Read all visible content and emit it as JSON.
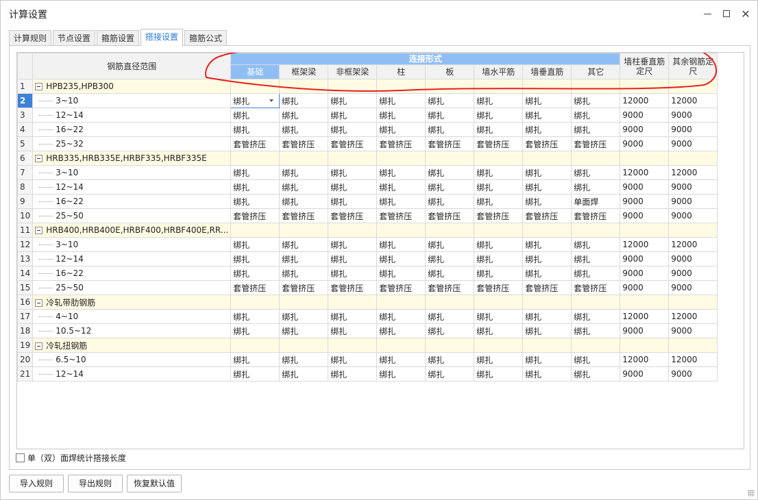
{
  "window": {
    "title": "计算设置"
  },
  "tabs": [
    {
      "label": "计算规则",
      "active": false
    },
    {
      "label": "节点设置",
      "active": false
    },
    {
      "label": "箍筋设置",
      "active": false
    },
    {
      "label": "搭接设置",
      "active": true
    },
    {
      "label": "箍筋公式",
      "active": false
    }
  ],
  "table": {
    "header": {
      "range": "钢筋直径范围",
      "group": "连接形式",
      "columns": [
        "基础",
        "框架梁",
        "非框架梁",
        "柱",
        "板",
        "墙水平筋",
        "墙垂直筋",
        "其它"
      ],
      "col_length1": "墙柱垂直筋定尺",
      "col_length2": "其余钢筋定尺"
    },
    "rows": [
      {
        "num": "1",
        "group": true,
        "name": "HPB235,HPB300"
      },
      {
        "num": "2",
        "group": false,
        "name": "3~10",
        "values": [
          "绑扎",
          "绑扎",
          "绑扎",
          "绑扎",
          "绑扎",
          "绑扎",
          "绑扎",
          "绑扎"
        ],
        "len1": "12000",
        "len2": "12000"
      },
      {
        "num": "3",
        "group": false,
        "name": "12~14",
        "values": [
          "绑扎",
          "绑扎",
          "绑扎",
          "绑扎",
          "绑扎",
          "绑扎",
          "绑扎",
          "绑扎"
        ],
        "len1": "9000",
        "len2": "9000"
      },
      {
        "num": "4",
        "group": false,
        "name": "16~22",
        "values": [
          "绑扎",
          "绑扎",
          "绑扎",
          "绑扎",
          "绑扎",
          "绑扎",
          "绑扎",
          "绑扎"
        ],
        "len1": "9000",
        "len2": "9000"
      },
      {
        "num": "5",
        "group": false,
        "name": "25~32",
        "values": [
          "套管挤压",
          "套管挤压",
          "套管挤压",
          "套管挤压",
          "套管挤压",
          "套管挤压",
          "套管挤压",
          "套管挤压"
        ],
        "len1": "9000",
        "len2": "9000"
      },
      {
        "num": "6",
        "group": true,
        "name": "HRB335,HRB335E,HRBF335,HRBF335E"
      },
      {
        "num": "7",
        "group": false,
        "name": "3~10",
        "values": [
          "绑扎",
          "绑扎",
          "绑扎",
          "绑扎",
          "绑扎",
          "绑扎",
          "绑扎",
          "绑扎"
        ],
        "len1": "12000",
        "len2": "12000"
      },
      {
        "num": "8",
        "group": false,
        "name": "12~14",
        "values": [
          "绑扎",
          "绑扎",
          "绑扎",
          "绑扎",
          "绑扎",
          "绑扎",
          "绑扎",
          "绑扎"
        ],
        "len1": "9000",
        "len2": "9000"
      },
      {
        "num": "9",
        "group": false,
        "name": "16~22",
        "values": [
          "绑扎",
          "绑扎",
          "绑扎",
          "绑扎",
          "绑扎",
          "绑扎",
          "绑扎",
          "单面焊"
        ],
        "len1": "9000",
        "len2": "9000"
      },
      {
        "num": "10",
        "group": false,
        "name": "25~50",
        "values": [
          "套管挤压",
          "套管挤压",
          "套管挤压",
          "套管挤压",
          "套管挤压",
          "套管挤压",
          "套管挤压",
          "套管挤压"
        ],
        "len1": "9000",
        "len2": "9000"
      },
      {
        "num": "11",
        "group": true,
        "name": "HRB400,HRB400E,HRBF400,HRBF400E,RR..."
      },
      {
        "num": "12",
        "group": false,
        "name": "3~10",
        "values": [
          "绑扎",
          "绑扎",
          "绑扎",
          "绑扎",
          "绑扎",
          "绑扎",
          "绑扎",
          "绑扎"
        ],
        "len1": "12000",
        "len2": "12000"
      },
      {
        "num": "13",
        "group": false,
        "name": "12~14",
        "values": [
          "绑扎",
          "绑扎",
          "绑扎",
          "绑扎",
          "绑扎",
          "绑扎",
          "绑扎",
          "绑扎"
        ],
        "len1": "9000",
        "len2": "9000"
      },
      {
        "num": "14",
        "group": false,
        "name": "16~22",
        "values": [
          "绑扎",
          "绑扎",
          "绑扎",
          "绑扎",
          "绑扎",
          "绑扎",
          "绑扎",
          "绑扎"
        ],
        "len1": "9000",
        "len2": "9000"
      },
      {
        "num": "15",
        "group": false,
        "name": "25~50",
        "values": [
          "套管挤压",
          "套管挤压",
          "套管挤压",
          "套管挤压",
          "套管挤压",
          "套管挤压",
          "套管挤压",
          "套管挤压"
        ],
        "len1": "9000",
        "len2": "9000"
      },
      {
        "num": "16",
        "group": true,
        "name": "冷轧带肋钢筋"
      },
      {
        "num": "17",
        "group": false,
        "name": "4~10",
        "values": [
          "绑扎",
          "绑扎",
          "绑扎",
          "绑扎",
          "绑扎",
          "绑扎",
          "绑扎",
          "绑扎"
        ],
        "len1": "12000",
        "len2": "12000"
      },
      {
        "num": "18",
        "group": false,
        "name": "10.5~12",
        "values": [
          "绑扎",
          "绑扎",
          "绑扎",
          "绑扎",
          "绑扎",
          "绑扎",
          "绑扎",
          "绑扎"
        ],
        "len1": "9000",
        "len2": "9000"
      },
      {
        "num": "19",
        "group": true,
        "name": "冷轧扭钢筋"
      },
      {
        "num": "20",
        "group": false,
        "name": "6.5~10",
        "values": [
          "绑扎",
          "绑扎",
          "绑扎",
          "绑扎",
          "绑扎",
          "绑扎",
          "绑扎",
          "绑扎"
        ],
        "len1": "12000",
        "len2": "12000"
      },
      {
        "num": "21",
        "group": false,
        "name": "12~14",
        "values": [
          "绑扎",
          "绑扎",
          "绑扎",
          "绑扎",
          "绑扎",
          "绑扎",
          "绑扎",
          "绑扎"
        ],
        "len1": "9000",
        "len2": "9000"
      }
    ]
  },
  "options": {
    "weld_checkbox_label": "单（双）面焊统计搭接长度",
    "weld_checked": false
  },
  "buttons": {
    "import": "导入规则",
    "export": "导出规则",
    "reset": "恢复默认值"
  },
  "annotation": {
    "color": "#e8201c"
  }
}
